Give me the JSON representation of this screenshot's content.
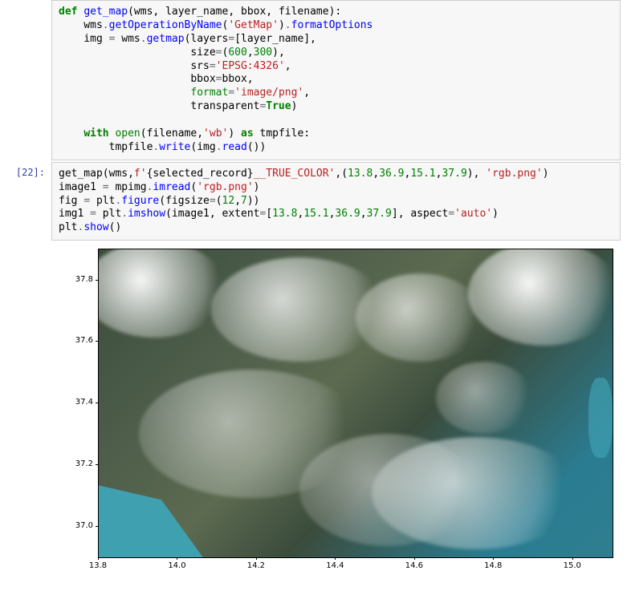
{
  "cell1": {
    "prompt": "",
    "code_tokens": [
      {
        "t": "def ",
        "c": "kw"
      },
      {
        "t": "get_map",
        "c": "fn"
      },
      {
        "t": "(wms, layer_name, bbox, filename):\n",
        "c": ""
      },
      {
        "t": "    wms",
        "c": ""
      },
      {
        "t": ".",
        "c": "op"
      },
      {
        "t": "getOperationByName",
        "c": "fn"
      },
      {
        "t": "(",
        "c": ""
      },
      {
        "t": "'GetMap'",
        "c": "str"
      },
      {
        "t": ")",
        "c": ""
      },
      {
        "t": ".",
        "c": "op"
      },
      {
        "t": "formatOptions",
        "c": "fn"
      },
      {
        "t": "\n",
        "c": ""
      },
      {
        "t": "    img ",
        "c": ""
      },
      {
        "t": "=",
        "c": "op"
      },
      {
        "t": " wms",
        "c": ""
      },
      {
        "t": ".",
        "c": "op"
      },
      {
        "t": "getmap",
        "c": "fn"
      },
      {
        "t": "(layers",
        "c": ""
      },
      {
        "t": "=",
        "c": "op"
      },
      {
        "t": "[layer_name],\n",
        "c": ""
      },
      {
        "t": "                     size",
        "c": ""
      },
      {
        "t": "=",
        "c": "op"
      },
      {
        "t": "(",
        "c": ""
      },
      {
        "t": "600",
        "c": "num"
      },
      {
        "t": ",",
        "c": ""
      },
      {
        "t": "300",
        "c": "num"
      },
      {
        "t": "),\n",
        "c": ""
      },
      {
        "t": "                     srs",
        "c": ""
      },
      {
        "t": "=",
        "c": "op"
      },
      {
        "t": "'EPSG:4326'",
        "c": "str"
      },
      {
        "t": ",\n",
        "c": ""
      },
      {
        "t": "                     bbox",
        "c": ""
      },
      {
        "t": "=",
        "c": "op"
      },
      {
        "t": "bbox,\n",
        "c": ""
      },
      {
        "t": "                     ",
        "c": ""
      },
      {
        "t": "format",
        "c": "builtin"
      },
      {
        "t": "=",
        "c": "op"
      },
      {
        "t": "'image/png'",
        "c": "str"
      },
      {
        "t": ",\n",
        "c": ""
      },
      {
        "t": "                     transparent",
        "c": ""
      },
      {
        "t": "=",
        "c": "op"
      },
      {
        "t": "True",
        "c": "bool"
      },
      {
        "t": ")\n\n",
        "c": ""
      },
      {
        "t": "    ",
        "c": ""
      },
      {
        "t": "with",
        "c": "kw"
      },
      {
        "t": " ",
        "c": ""
      },
      {
        "t": "open",
        "c": "builtin"
      },
      {
        "t": "(filename,",
        "c": ""
      },
      {
        "t": "'wb'",
        "c": "str"
      },
      {
        "t": ") ",
        "c": ""
      },
      {
        "t": "as",
        "c": "kw"
      },
      {
        "t": " tmpfile:\n",
        "c": ""
      },
      {
        "t": "        tmpfile",
        "c": ""
      },
      {
        "t": ".",
        "c": "op"
      },
      {
        "t": "write",
        "c": "fn"
      },
      {
        "t": "(img",
        "c": ""
      },
      {
        "t": ".",
        "c": "op"
      },
      {
        "t": "read",
        "c": "fn"
      },
      {
        "t": "())",
        "c": ""
      }
    ]
  },
  "cell2": {
    "prompt": "[22]:",
    "code_tokens": [
      {
        "t": "get_map(wms,",
        "c": ""
      },
      {
        "t": "f'",
        "c": "str"
      },
      {
        "t": "{selected_record}",
        "c": ""
      },
      {
        "t": "__TRUE_COLOR'",
        "c": "str"
      },
      {
        "t": ",(",
        "c": ""
      },
      {
        "t": "13.8",
        "c": "num"
      },
      {
        "t": ",",
        "c": ""
      },
      {
        "t": "36.9",
        "c": "num"
      },
      {
        "t": ",",
        "c": ""
      },
      {
        "t": "15.1",
        "c": "num"
      },
      {
        "t": ",",
        "c": ""
      },
      {
        "t": "37.9",
        "c": "num"
      },
      {
        "t": "), ",
        "c": ""
      },
      {
        "t": "'rgb.png'",
        "c": "str"
      },
      {
        "t": ")\n",
        "c": ""
      },
      {
        "t": "image1 ",
        "c": ""
      },
      {
        "t": "=",
        "c": "op"
      },
      {
        "t": " mpimg",
        "c": ""
      },
      {
        "t": ".",
        "c": "op"
      },
      {
        "t": "imread",
        "c": "fn"
      },
      {
        "t": "(",
        "c": ""
      },
      {
        "t": "'rgb.png'",
        "c": "str"
      },
      {
        "t": ")\n",
        "c": ""
      },
      {
        "t": "fig ",
        "c": ""
      },
      {
        "t": "=",
        "c": "op"
      },
      {
        "t": " plt",
        "c": ""
      },
      {
        "t": ".",
        "c": "op"
      },
      {
        "t": "figure",
        "c": "fn"
      },
      {
        "t": "(figsize",
        "c": ""
      },
      {
        "t": "=",
        "c": "op"
      },
      {
        "t": "(",
        "c": ""
      },
      {
        "t": "12",
        "c": "num"
      },
      {
        "t": ",",
        "c": ""
      },
      {
        "t": "7",
        "c": "num"
      },
      {
        "t": "))\n",
        "c": ""
      },
      {
        "t": "img1 ",
        "c": ""
      },
      {
        "t": "=",
        "c": "op"
      },
      {
        "t": " plt",
        "c": ""
      },
      {
        "t": ".",
        "c": "op"
      },
      {
        "t": "imshow",
        "c": "fn"
      },
      {
        "t": "(image1, extent",
        "c": ""
      },
      {
        "t": "=",
        "c": "op"
      },
      {
        "t": "[",
        "c": ""
      },
      {
        "t": "13.8",
        "c": "num"
      },
      {
        "t": ",",
        "c": ""
      },
      {
        "t": "15.1",
        "c": "num"
      },
      {
        "t": ",",
        "c": ""
      },
      {
        "t": "36.9",
        "c": "num"
      },
      {
        "t": ",",
        "c": ""
      },
      {
        "t": "37.9",
        "c": "num"
      },
      {
        "t": "], aspect",
        "c": ""
      },
      {
        "t": "=",
        "c": "op"
      },
      {
        "t": "'auto'",
        "c": "str"
      },
      {
        "t": ")\n",
        "c": ""
      },
      {
        "t": "plt",
        "c": ""
      },
      {
        "t": ".",
        "c": "op"
      },
      {
        "t": "show",
        "c": "fn"
      },
      {
        "t": "()",
        "c": ""
      }
    ]
  },
  "chart_data": {
    "type": "image",
    "extent": {
      "xmin": 13.8,
      "xmax": 15.1,
      "ymin": 36.9,
      "ymax": 37.9
    },
    "xlabel": "",
    "ylabel": "",
    "xticks": [
      13.8,
      14.0,
      14.2,
      14.4,
      14.6,
      14.8,
      15.0
    ],
    "yticks": [
      37.0,
      37.2,
      37.4,
      37.6,
      37.8
    ],
    "figsize": [
      12,
      7
    ],
    "aspect": "auto",
    "description": "Satellite true-color imagery of southeastern Sicily (Italy) with clouds over land and Mediterranean Sea in the lower-left corner"
  }
}
